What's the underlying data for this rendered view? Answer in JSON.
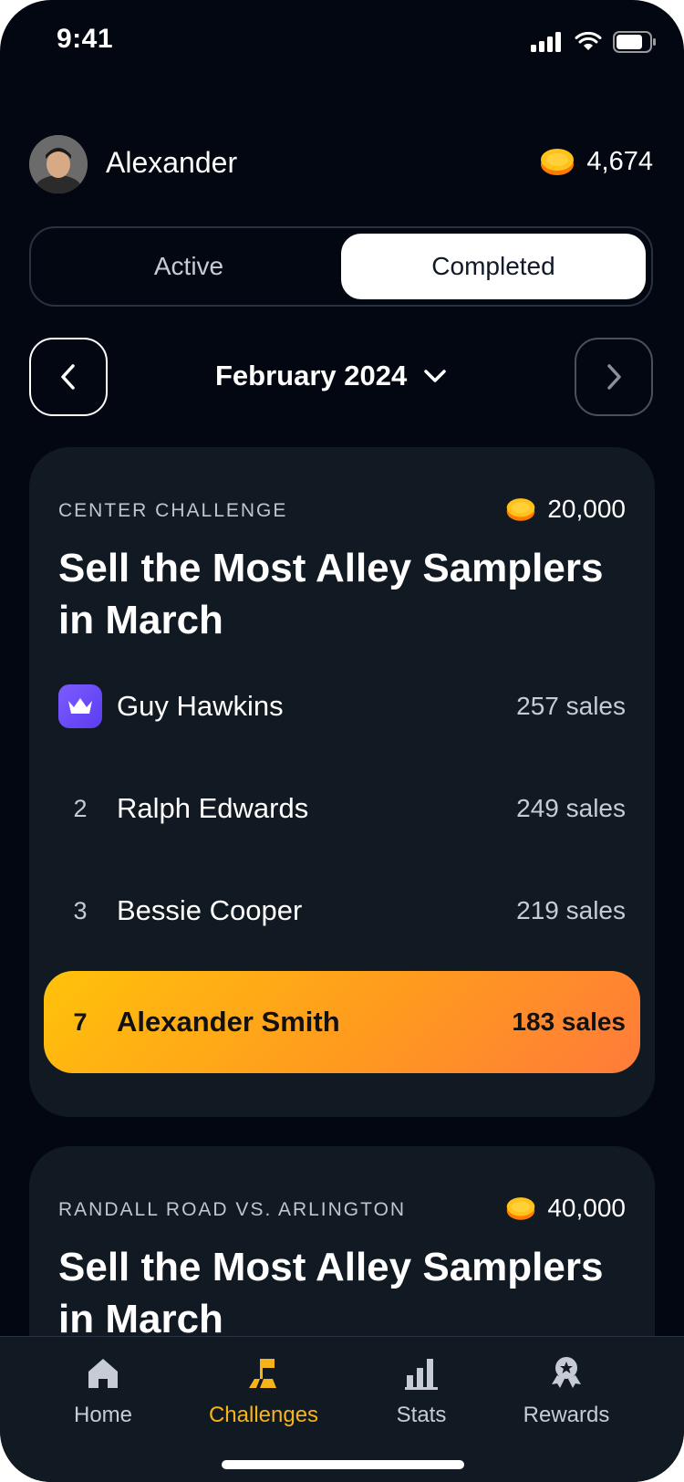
{
  "status_bar": {
    "time": "9:41"
  },
  "header": {
    "username": "Alexander",
    "balance": "4,674"
  },
  "segmented": {
    "active_label": "Active",
    "completed_label": "Completed",
    "selected": "Completed"
  },
  "month_nav": {
    "month": "February 2024"
  },
  "challenges": [
    {
      "eyebrow": "CENTER CHALLENGE",
      "prize": "20,000",
      "title": "Sell the Most Alley Samplers in March",
      "leaderboard": [
        {
          "rank": "1",
          "name": "Guy Hawkins",
          "sales": "257 sales",
          "crown": true
        },
        {
          "rank": "2",
          "name": "Ralph Edwards",
          "sales": "249 sales"
        },
        {
          "rank": "3",
          "name": "Bessie Cooper",
          "sales": "219 sales"
        }
      ],
      "current_user": {
        "rank": "7",
        "name": "Alexander Smith",
        "sales": "183 sales"
      }
    },
    {
      "eyebrow": "RANDALL ROAD VS. ARLINGTON",
      "prize": "40,000",
      "title": "Sell the Most Alley Samplers in March"
    }
  ],
  "tabbar": {
    "items": [
      {
        "label": "Home",
        "icon": "home-icon"
      },
      {
        "label": "Challenges",
        "icon": "challenges-icon",
        "active": true
      },
      {
        "label": "Stats",
        "icon": "stats-icon"
      },
      {
        "label": "Rewards",
        "icon": "rewards-icon"
      }
    ]
  },
  "colors": {
    "background": "#030711",
    "card": "#111922",
    "accent": "#f6b41a",
    "highlight_start": "#ffc20a",
    "highlight_end": "#ff7b3a",
    "crown": "#6a4cff"
  }
}
